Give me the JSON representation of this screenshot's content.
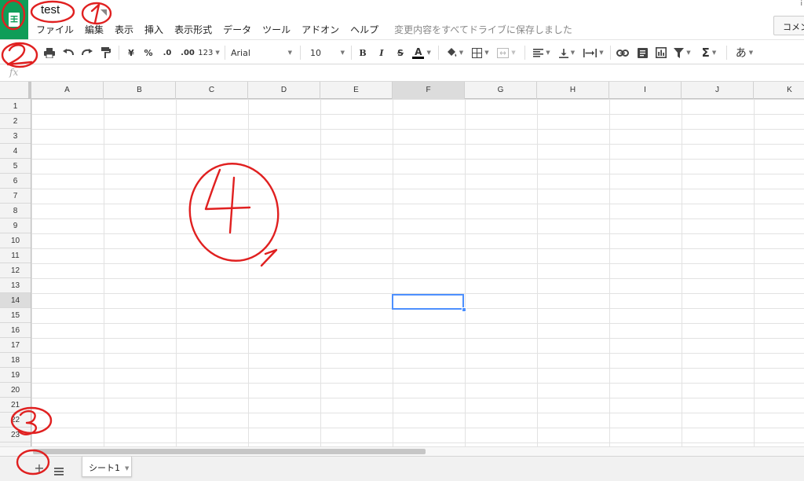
{
  "document": {
    "title": "test"
  },
  "menu": {
    "items": [
      "ファイル",
      "編集",
      "表示",
      "挿入",
      "表示形式",
      "データ",
      "ツール",
      "アドオン",
      "ヘルプ"
    ],
    "save_status": "変更内容をすべてドライブに保存しました"
  },
  "header": {
    "comment_button": "コメント",
    "top_right_mark": "i"
  },
  "toolbar": {
    "currency": "¥",
    "percent": "%",
    "decrease_decimals": ".0",
    "increase_decimals": ".00",
    "more_formats": "123",
    "font_family": "Arial",
    "font_size": "10",
    "bold": "B",
    "italic": "I",
    "strikethrough": "S",
    "text_color": "A",
    "input_tools": "あ",
    "text_color_hex": "#000000"
  },
  "formula_bar": {
    "fx_label": "fx",
    "value": ""
  },
  "grid": {
    "columns": [
      "A",
      "B",
      "C",
      "D",
      "E",
      "F",
      "G",
      "H",
      "I",
      "J",
      "K"
    ],
    "rows": [
      "1",
      "2",
      "3",
      "4",
      "5",
      "6",
      "7",
      "8",
      "9",
      "10",
      "11",
      "12",
      "13",
      "14",
      "15",
      "16",
      "17",
      "18",
      "19",
      "20",
      "21",
      "22",
      "23"
    ],
    "active_cell": {
      "column": "F",
      "row": "14"
    },
    "selection_color": "#4d90fe"
  },
  "sheets": {
    "tabs": [
      {
        "label": "シート1",
        "active": true
      }
    ]
  },
  "annotations": {
    "color": "#e02020",
    "labels": [
      "1",
      "2",
      "3",
      "4"
    ]
  },
  "theme": {
    "brand_green": "#0f9d58"
  }
}
